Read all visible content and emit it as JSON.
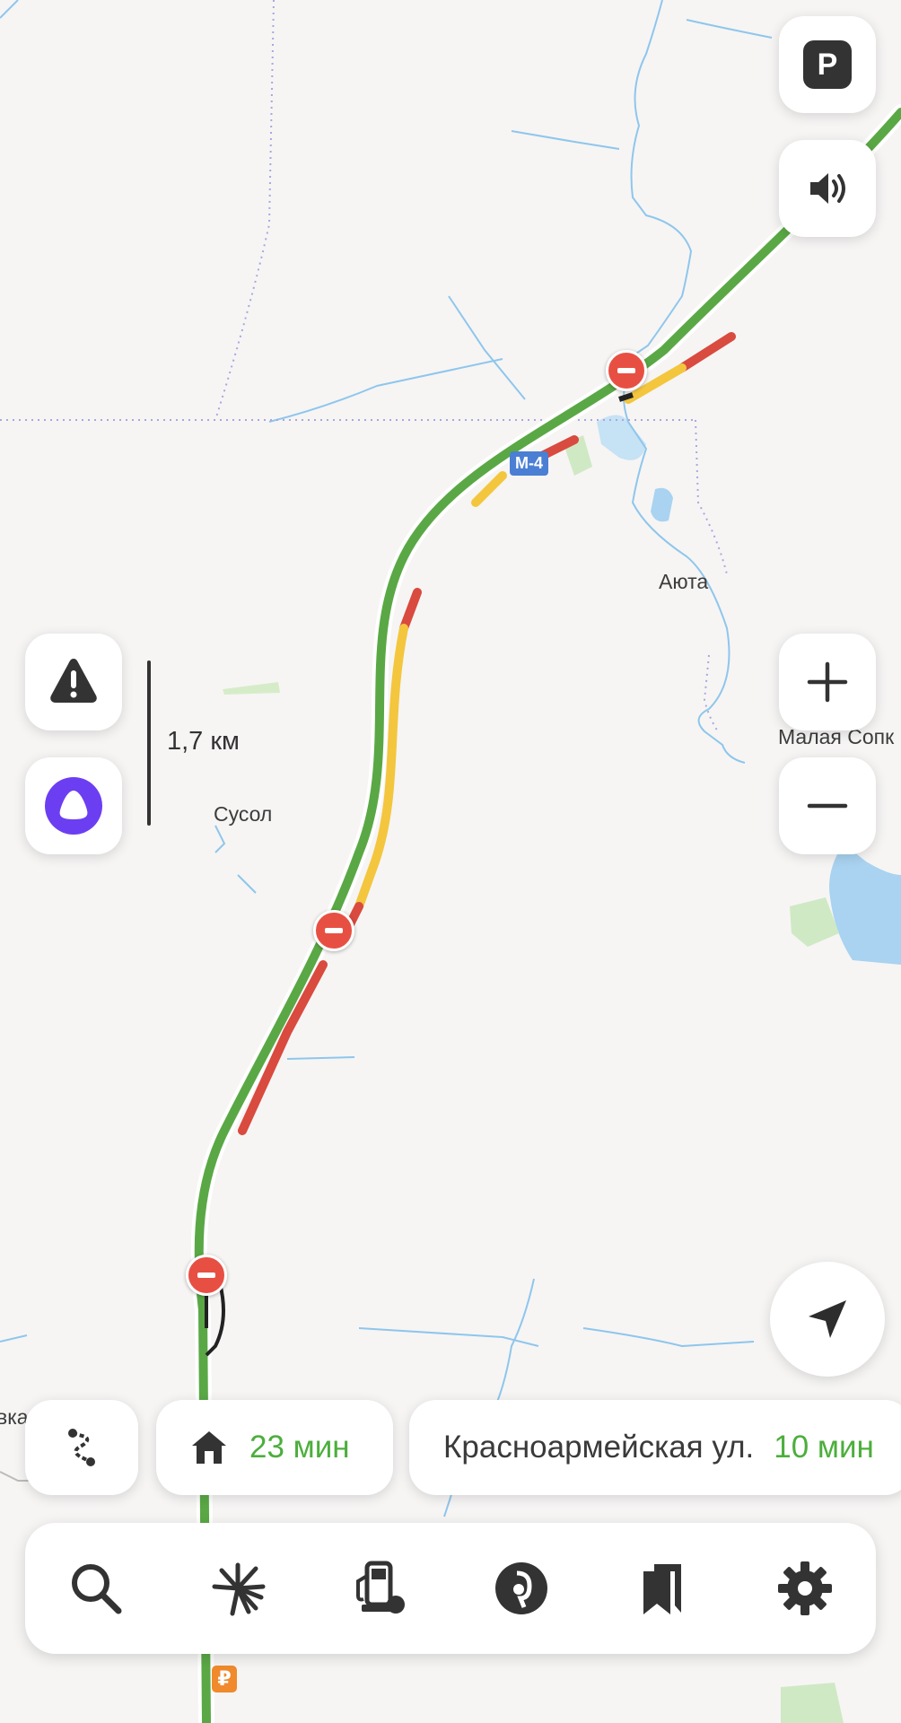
{
  "map": {
    "places": {
      "auta": "Аюта",
      "malaya_sopka": "Малая Сопк",
      "susol": "Сусол",
      "left_edge": "вка"
    },
    "road_shield": "M-4",
    "scale_label": "1,7 км",
    "currency_symbol": "₽"
  },
  "routes": {
    "home_time": "23 мин",
    "destination_name": "Красноармейская ул.",
    "destination_time": "10 мин"
  },
  "icons": {
    "parking": "parking-icon",
    "sound": "speaker-icon",
    "report": "warning-icon",
    "assistant": "alice-icon",
    "zoom_in": "plus-icon",
    "zoom_out": "minus-icon",
    "locate": "navigation-arrow-icon",
    "route_overview": "route-icon",
    "home": "home-icon",
    "tabs": [
      "search-icon",
      "discovery-icon",
      "fuel-icon",
      "music-icon",
      "bookmarks-icon",
      "settings-icon"
    ]
  },
  "colors": {
    "traffic_free": "#5aa845",
    "traffic_slow": "#f3c63e",
    "traffic_jam": "#d94a3f",
    "water": "#a9d3f0",
    "accent_purple": "#6c3ef2",
    "time_green": "#4cae3c"
  }
}
